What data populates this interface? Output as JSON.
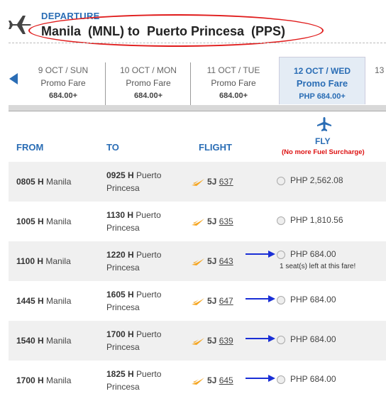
{
  "header": {
    "departure_label": "DEPARTURE",
    "route": "Manila  (MNL) to  Puerto Princesa  (PPS)"
  },
  "dates": [
    {
      "date": "9 OCT / SUN",
      "fare": "Promo Fare",
      "price": "684.00+"
    },
    {
      "date": "10 OCT / MON",
      "fare": "Promo Fare",
      "price": "684.00+"
    },
    {
      "date": "11 OCT / TUE",
      "fare": "Promo Fare",
      "price": "684.00+"
    },
    {
      "date": "12 OCT / WED",
      "fare": "Promo Fare",
      "price": "PHP 684.00+"
    },
    {
      "date": "13"
    }
  ],
  "columns": {
    "from": "FROM",
    "to": "TO",
    "flight": "FLIGHT",
    "fly": "FLY",
    "surcharge": "(No more Fuel Surcharge)"
  },
  "flights": [
    {
      "dep_time": "0805 H",
      "dep_city": "Manila",
      "arr_time": "0925 H",
      "arr_city_1": "Puerto",
      "arr_city_2": "Princesa",
      "airline": "5J",
      "number": "637",
      "price": "PHP 2,562.08",
      "seats": ""
    },
    {
      "dep_time": "1005 H",
      "dep_city": "Manila",
      "arr_time": "1130 H",
      "arr_city_1": "Puerto",
      "arr_city_2": "Princesa",
      "airline": "5J",
      "number": "635",
      "price": "PHP 1,810.56",
      "seats": ""
    },
    {
      "dep_time": "1100 H",
      "dep_city": "Manila",
      "arr_time": "1220 H",
      "arr_city_1": "Puerto",
      "arr_city_2": "Princesa",
      "airline": "5J",
      "number": "643",
      "price": "PHP 684.00",
      "seats": "1 seat(s) left at this fare!"
    },
    {
      "dep_time": "1445 H",
      "dep_city": "Manila",
      "arr_time": "1605 H",
      "arr_city_1": "Puerto",
      "arr_city_2": "Princesa",
      "airline": "5J",
      "number": "647",
      "price": "PHP 684.00",
      "seats": ""
    },
    {
      "dep_time": "1540 H",
      "dep_city": "Manila",
      "arr_time": "1700 H",
      "arr_city_1": "Puerto",
      "arr_city_2": "Princesa",
      "airline": "5J",
      "number": "639",
      "price": "PHP 684.00",
      "seats": ""
    },
    {
      "dep_time": "1700 H",
      "dep_city": "Manila",
      "arr_time": "1825 H",
      "arr_city_1": "Puerto",
      "arr_city_2": "Princesa",
      "airline": "5J",
      "number": "645",
      "price": "PHP 684.00",
      "seats": ""
    }
  ],
  "colors": {
    "accent": "#2a6db5",
    "highlight_oval": "#e01b1b",
    "arrow": "#1a2fd6",
    "airline_icon": "#f5a623"
  }
}
